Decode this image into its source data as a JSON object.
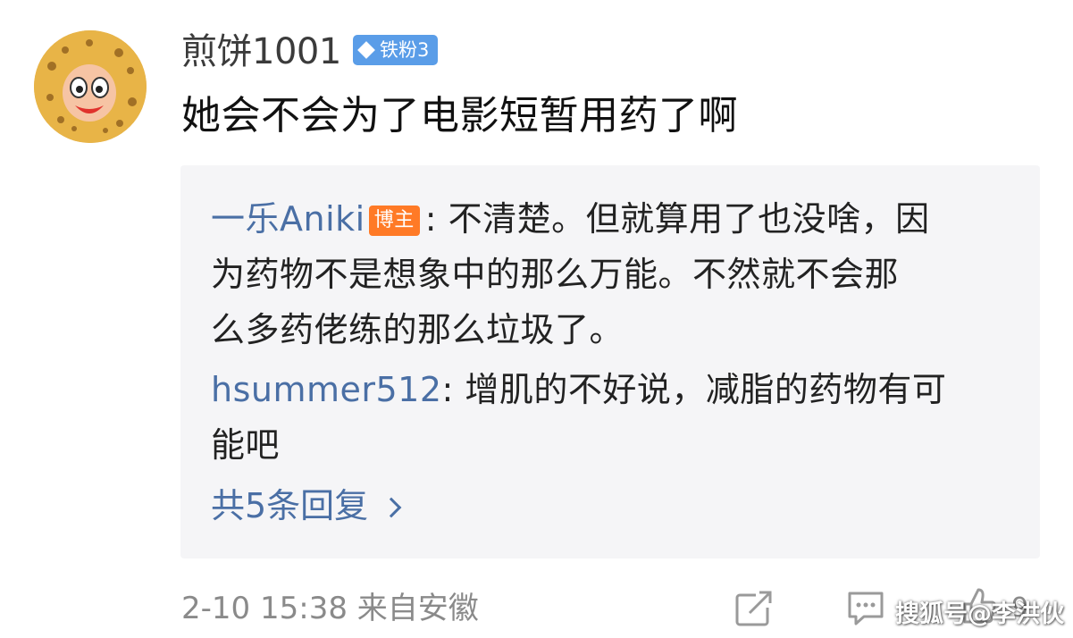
{
  "user": {
    "name": "煎饼1001",
    "badge": "铁粉3"
  },
  "comment": {
    "text": "她会不会为了电影短暂用药了啊"
  },
  "replies": [
    {
      "author": "一乐Aniki",
      "tag": "博主",
      "sep": ": ",
      "lines": [
        "不清楚。但就算用了也没啥，因",
        "为药物不是想象中的那么万能。不然就不会那",
        "么多药佬练的那么垃圾了。"
      ]
    },
    {
      "author": "hsummer512",
      "sep": ": ",
      "lines": [
        "增肌的不好说，减脂的药物有可",
        "能吧"
      ]
    }
  ],
  "more_replies": "共5条回复",
  "meta": {
    "time": "2-10 15:38",
    "location": "来自安徽"
  },
  "actions": {
    "like_count": "9"
  },
  "watermark": "搜狐号@李洪伙",
  "colors": {
    "link": "#4a6fa5",
    "badge": "#5a9de8",
    "host_tag": "#ff7a26",
    "reply_bg": "#f5f5f7"
  },
  "icons": [
    "share-icon",
    "comment-icon",
    "like-icon",
    "chevron-right-icon",
    "diamond-icon"
  ]
}
